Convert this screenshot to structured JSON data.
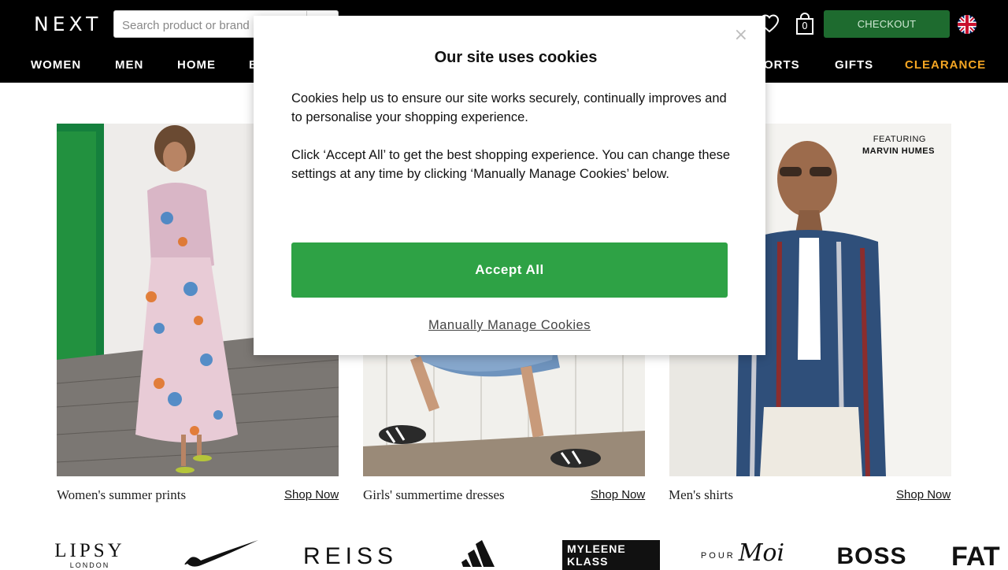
{
  "header": {
    "logo_text": "NEXT",
    "search_placeholder": "Search product or brand",
    "bag_count": "0",
    "checkout_label": "CHECKOUT",
    "checkout_color": "#1e6b2f",
    "icons": [
      "heart-icon",
      "shopping-bag-icon",
      "uk-flag-icon"
    ]
  },
  "nav": {
    "items": [
      {
        "label": "WOMEN"
      },
      {
        "label": "MEN"
      },
      {
        "label": "HOME"
      },
      {
        "label": "B"
      },
      {
        "label": "ORTS"
      },
      {
        "label": "GIFTS"
      },
      {
        "label": "CLEARANCE",
        "color": "#f5a623"
      }
    ]
  },
  "tiles": [
    {
      "caption": "Women's summer prints",
      "link": "Shop Now"
    },
    {
      "caption": "Girls' summertime dresses",
      "link": "Shop Now"
    },
    {
      "caption": "Men's shirts",
      "link": "Shop Now",
      "overlay_line1": "FEATURING",
      "overlay_line2": "MARVIN HUMES"
    }
  ],
  "brands": [
    {
      "name": "LIPSY",
      "sub": "LONDON"
    },
    {
      "name": "nike-swoosh"
    },
    {
      "name": "REISS"
    },
    {
      "name": "adidas"
    },
    {
      "name": "MYLEENE KLASS"
    },
    {
      "name": "POUR",
      "script": "Moi"
    },
    {
      "name": "BOSS"
    },
    {
      "name": "FAT"
    }
  ],
  "cookie_modal": {
    "title": "Our site uses cookies",
    "paragraph1": "Cookies help us to ensure our site works securely, continually improves and to personalise your shopping experience.",
    "paragraph2": "Click ‘Accept All’ to get the best shopping experience. You can change these settings at any time by clicking ‘Manually Manage Cookies’ below.",
    "accept_label": "Accept All",
    "manage_label": "Manually Manage Cookies",
    "close_label": "×",
    "accept_color": "#2ea245"
  }
}
